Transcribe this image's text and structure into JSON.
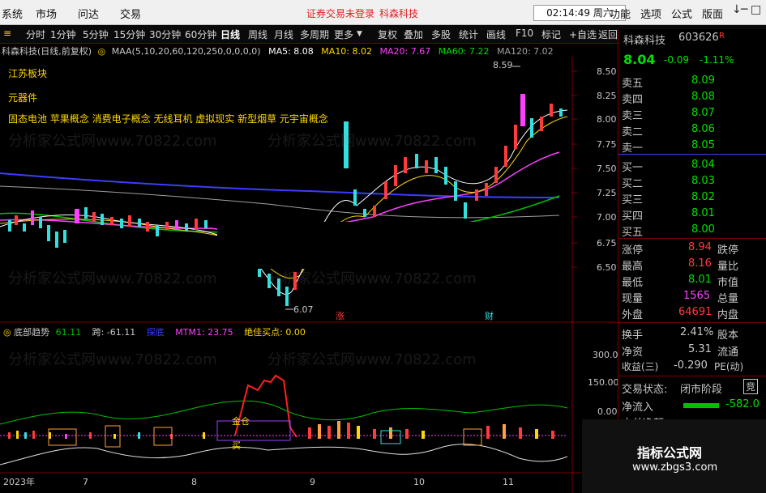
{
  "menubar": {
    "items": [
      "系统",
      "市场",
      "问达",
      "交易"
    ],
    "notice1": "证券交易未登录",
    "notice2": "科森科技",
    "clock": "02:14:49 周六",
    "right_items": [
      "功能",
      "选项",
      "公式",
      "版面"
    ],
    "win_controls": [
      "↓",
      "─",
      "□",
      "✕"
    ]
  },
  "toolbar": {
    "period_items": [
      "分时",
      "1分钟",
      "5分钟",
      "15分钟",
      "30分钟",
      "60分钟",
      "日线",
      "周线",
      "月线",
      "多周期",
      "更多"
    ],
    "active": "日线",
    "action_items": [
      "复权",
      "叠加",
      "多股",
      "统计",
      "画线",
      "F10",
      "标记",
      "+自选",
      "返回"
    ]
  },
  "chart_header": {
    "stock": "科森科技(日线,前复权)",
    "maa": "MAA(5,10,20,60,120,250,0,0,0,0)",
    "ma5": "MA5: 8.08",
    "ma10": "MA10: 8.02",
    "ma20": "MA20: 7.67",
    "ma60": "MA60: 7.22",
    "ma120": "MA120: 7.02"
  },
  "concepts": {
    "line1": "江苏板块",
    "line2": "元器件",
    "line3": "固态电池  苹果概念  消费电子概念  无线耳机  虚拟现实  新型烟草  元宇宙概念"
  },
  "annotations": {
    "high": "8.59",
    "low": "6.07",
    "marker_zhang": "涨",
    "marker_cai": "财"
  },
  "indicator_header": {
    "name": "底部趋势",
    "v1": "61.11",
    "v2": "跨: -61.11",
    "v3": "探底",
    "mtm": "MTM1: 23.75",
    "best": "绝佳买点: 0.00"
  },
  "indicator_labels": {
    "hold": "金仓",
    "buy": "买"
  },
  "x_axis": [
    "2023年",
    "7",
    "8",
    "9",
    "10",
    "11"
  ],
  "price_axis": [
    "8.50",
    "8.25",
    "8.00",
    "7.75",
    "7.50",
    "7.25",
    "7.00",
    "6.75",
    "6.50"
  ],
  "ind_axis": [
    "300.0",
    "150.00",
    "0.00"
  ],
  "watermark": "分析家公式网www.70822.com",
  "quote": {
    "name": "科森科技",
    "code": "603626",
    "code_flag": "R",
    "price": "8.04",
    "change": "-0.09",
    "pct": "-1.11%",
    "asks": [
      {
        "label": "卖五",
        "price": "8.09"
      },
      {
        "label": "卖四",
        "price": "8.08"
      },
      {
        "label": "卖三",
        "price": "8.07"
      },
      {
        "label": "卖二",
        "price": "8.06"
      },
      {
        "label": "卖一",
        "price": "8.05"
      }
    ],
    "bids": [
      {
        "label": "买一",
        "price": "8.04"
      },
      {
        "label": "买二",
        "price": "8.03"
      },
      {
        "label": "买三",
        "price": "8.02"
      },
      {
        "label": "买四",
        "price": "8.01"
      },
      {
        "label": "买五",
        "price": "8.00"
      }
    ],
    "stats": [
      {
        "label": "涨停",
        "value": "8.94",
        "label2": "跌停"
      },
      {
        "label": "最高",
        "value": "8.16",
        "label2": "量比"
      },
      {
        "label": "最低",
        "value": "8.01",
        "label2": "市值"
      },
      {
        "label": "现量",
        "value": "1565",
        "label2": "总量"
      },
      {
        "label": "外盘",
        "value": "64691",
        "label2": "内盘"
      }
    ],
    "stats2": [
      {
        "label": "换手",
        "value": "2.41%",
        "label2": "股本"
      },
      {
        "label": "净资",
        "value": "5.31",
        "label2": "流通"
      },
      {
        "label": "收益(三)",
        "value": "-0.290",
        "label2": "PE(动)"
      }
    ],
    "status_label": "交易状态:",
    "status_value": "闭市阶段",
    "status_tag": "竞",
    "netflow_label": "净流入",
    "netflow_value": "-582.0",
    "netflow2_label": "大单净额"
  },
  "badge": {
    "title": "指标公式网",
    "url": "www.zbgs3.com"
  },
  "colors": {
    "up": "#ff3b3b",
    "down": "#33e0e0",
    "green": "#00e000",
    "yellow": "#ffd700",
    "magenta": "#ff40ff",
    "axis_red": "#7a0000"
  }
}
